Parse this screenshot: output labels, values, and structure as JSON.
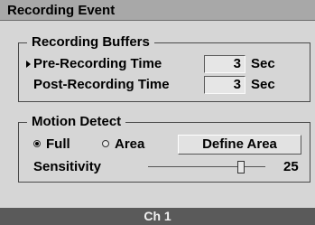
{
  "window": {
    "title": "Recording Event"
  },
  "recording_buffers": {
    "legend": "Recording Buffers",
    "pre_recording": {
      "label": "Pre-Recording Time",
      "value": "3",
      "unit": "Sec"
    },
    "post_recording": {
      "label": "Post-Recording Time",
      "value": "3",
      "unit": "Sec"
    }
  },
  "motion_detect": {
    "legend": "Motion Detect",
    "options": [
      {
        "label": "Full",
        "selected": true
      },
      {
        "label": "Area",
        "selected": false
      }
    ],
    "define_area_label": "Define Area",
    "sensitivity": {
      "label": "Sensitivity",
      "value": "25"
    }
  },
  "footer": {
    "channel": "Ch 1"
  }
}
